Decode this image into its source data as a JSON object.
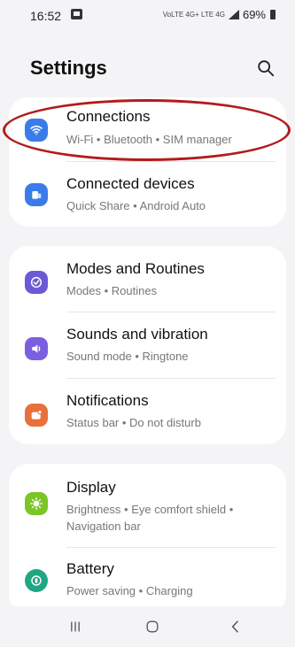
{
  "status_bar": {
    "time": "16:52",
    "signal_text": "VoLTE 4G+ LTE 4G",
    "battery": "69%"
  },
  "header": {
    "title": "Settings"
  },
  "groups": [
    {
      "items": [
        {
          "title": "Connections",
          "subtitle": "Wi-Fi  •  Bluetooth  •  SIM manager",
          "icon": "wifi-icon",
          "color": "#3a7bea"
        },
        {
          "title": "Connected devices",
          "subtitle": "Quick Share  •  Android Auto",
          "icon": "devices-icon",
          "color": "#3a7bea"
        }
      ]
    },
    {
      "items": [
        {
          "title": "Modes and Routines",
          "subtitle": "Modes  •  Routines",
          "icon": "check-circle-icon",
          "color": "#6b5ad6"
        },
        {
          "title": "Sounds and vibration",
          "subtitle": "Sound mode  •  Ringtone",
          "icon": "speaker-icon",
          "color": "#7b5fe0"
        },
        {
          "title": "Notifications",
          "subtitle": "Status bar  •  Do not disturb",
          "icon": "notification-icon",
          "color": "#e8703a"
        }
      ]
    },
    {
      "items": [
        {
          "title": "Display",
          "subtitle_line1": "Brightness  •  Eye comfort shield  •",
          "subtitle_line2": "Navigation bar",
          "icon": "sun-icon",
          "color": "#7cc42a"
        },
        {
          "title": "Battery",
          "subtitle": "Power saving  •  Charging",
          "icon": "battery-icon",
          "color": "#20a585"
        }
      ]
    }
  ]
}
